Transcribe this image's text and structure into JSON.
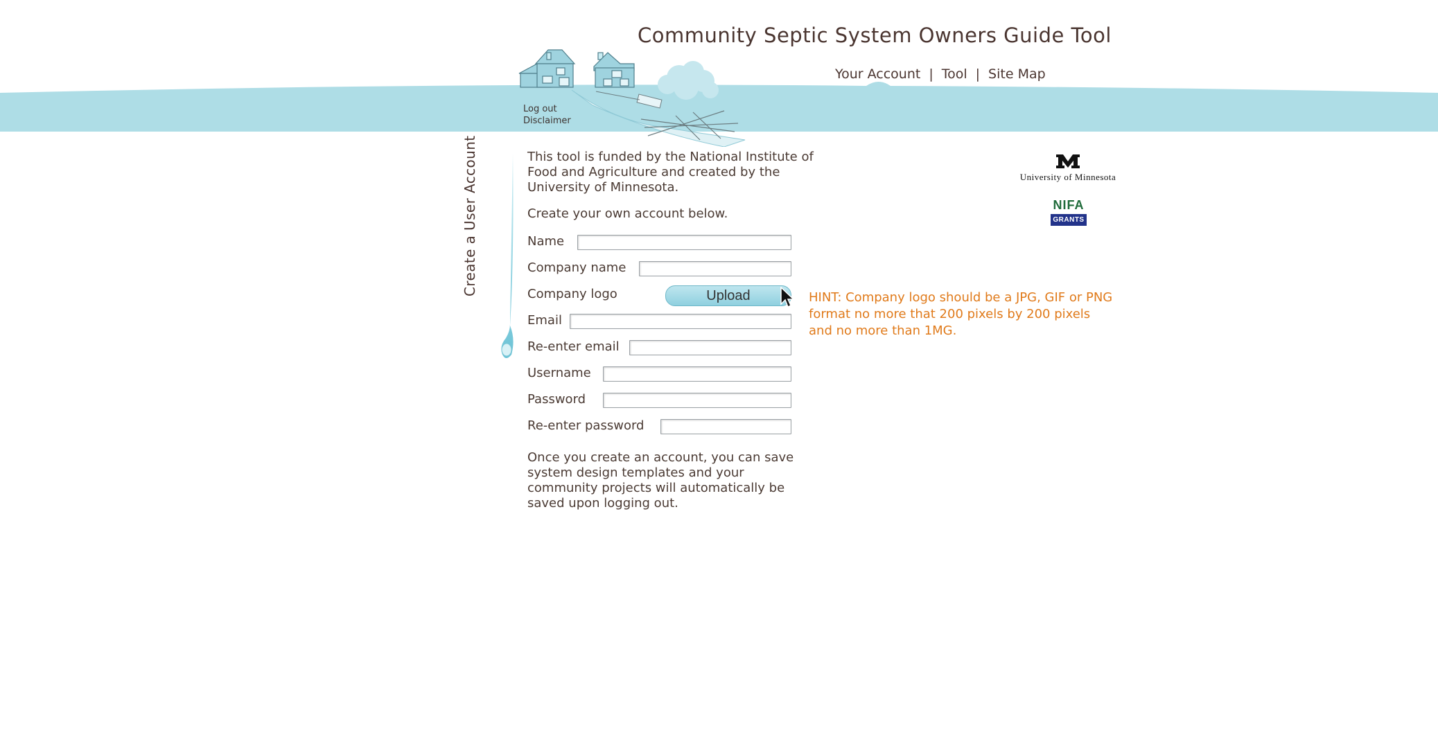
{
  "header": {
    "title": "Community Septic System Owners Guide Tool",
    "nav": [
      {
        "label": "Your Account"
      },
      {
        "label": "Tool"
      },
      {
        "label": "Site Map"
      }
    ],
    "separator": "|",
    "links": {
      "logout": "Log out",
      "disclaimer": "Disclaimer"
    },
    "band_color": "#aedde6"
  },
  "sidebar": {
    "title": "Create a User Account"
  },
  "content": {
    "intro": "This tool is funded by the National Institute of Food and Agriculture and created by the University of Minnesota.",
    "create_line": "Create your own account below.",
    "outro": "Once you create an account, you can save system design templates and your community projects will automatically be saved upon logging out."
  },
  "form": {
    "name_label": "Name",
    "company_name_label": "Company name",
    "company_logo_label": "Company logo",
    "upload_label": "Upload",
    "email_label": "Email",
    "reenter_email_label": "Re-enter email",
    "username_label": "Username",
    "password_label": "Password",
    "reenter_password_label": "Re-enter password",
    "values": {
      "name": "",
      "company_name": "",
      "email": "",
      "reenter_email": "",
      "username": "",
      "password": "",
      "reenter_password": ""
    }
  },
  "hint": "HINT: Company logo should be a JPG, GIF or PNG format no more that 200 pixels by 200 pixels and no more than 1MG.",
  "logos": {
    "umn": "University of Minnesota",
    "nifa": "NIFA",
    "nifa_sub": "GRANTS"
  },
  "colors": {
    "accent": "#aedde6",
    "hint": "#e07a1a",
    "text": "#4a3a33"
  }
}
